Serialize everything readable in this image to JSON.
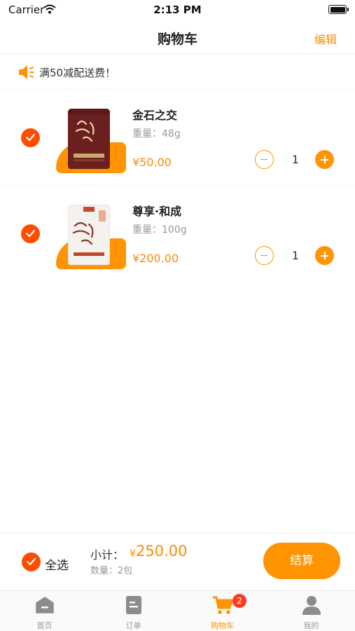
{
  "status_bar": {
    "carrier": "Carrier",
    "time": "2:13 PM"
  },
  "header": {
    "title": "购物车",
    "edit_label": "编辑"
  },
  "notice": {
    "text": "满50减配送费！"
  },
  "cart": {
    "items": [
      {
        "name": "金石之交",
        "weight": "重量：48g",
        "price": "¥50.00",
        "quantity": "1",
        "selected": true
      },
      {
        "name": "尊享·和成",
        "weight": "重量：100g",
        "price": "¥200.00",
        "quantity": "1",
        "selected": true
      }
    ]
  },
  "summary": {
    "select_all_label": "全选",
    "subtotal_label": "小计：",
    "subtotal_currency": "¥",
    "subtotal_value": "250.00",
    "quantity_text": "数量：2包",
    "checkout_label": "结算"
  },
  "tab_bar": {
    "tabs": [
      {
        "label": "首页",
        "icon": "home-icon"
      },
      {
        "label": "订单",
        "icon": "order-icon"
      },
      {
        "label": "购物车",
        "icon": "cart-icon",
        "active": true,
        "badge": "2"
      },
      {
        "label": "我的",
        "icon": "profile-icon"
      }
    ]
  },
  "colors": {
    "accent": "#ff9300",
    "check": "#ff4d00",
    "badge": "#ff3b1f"
  }
}
